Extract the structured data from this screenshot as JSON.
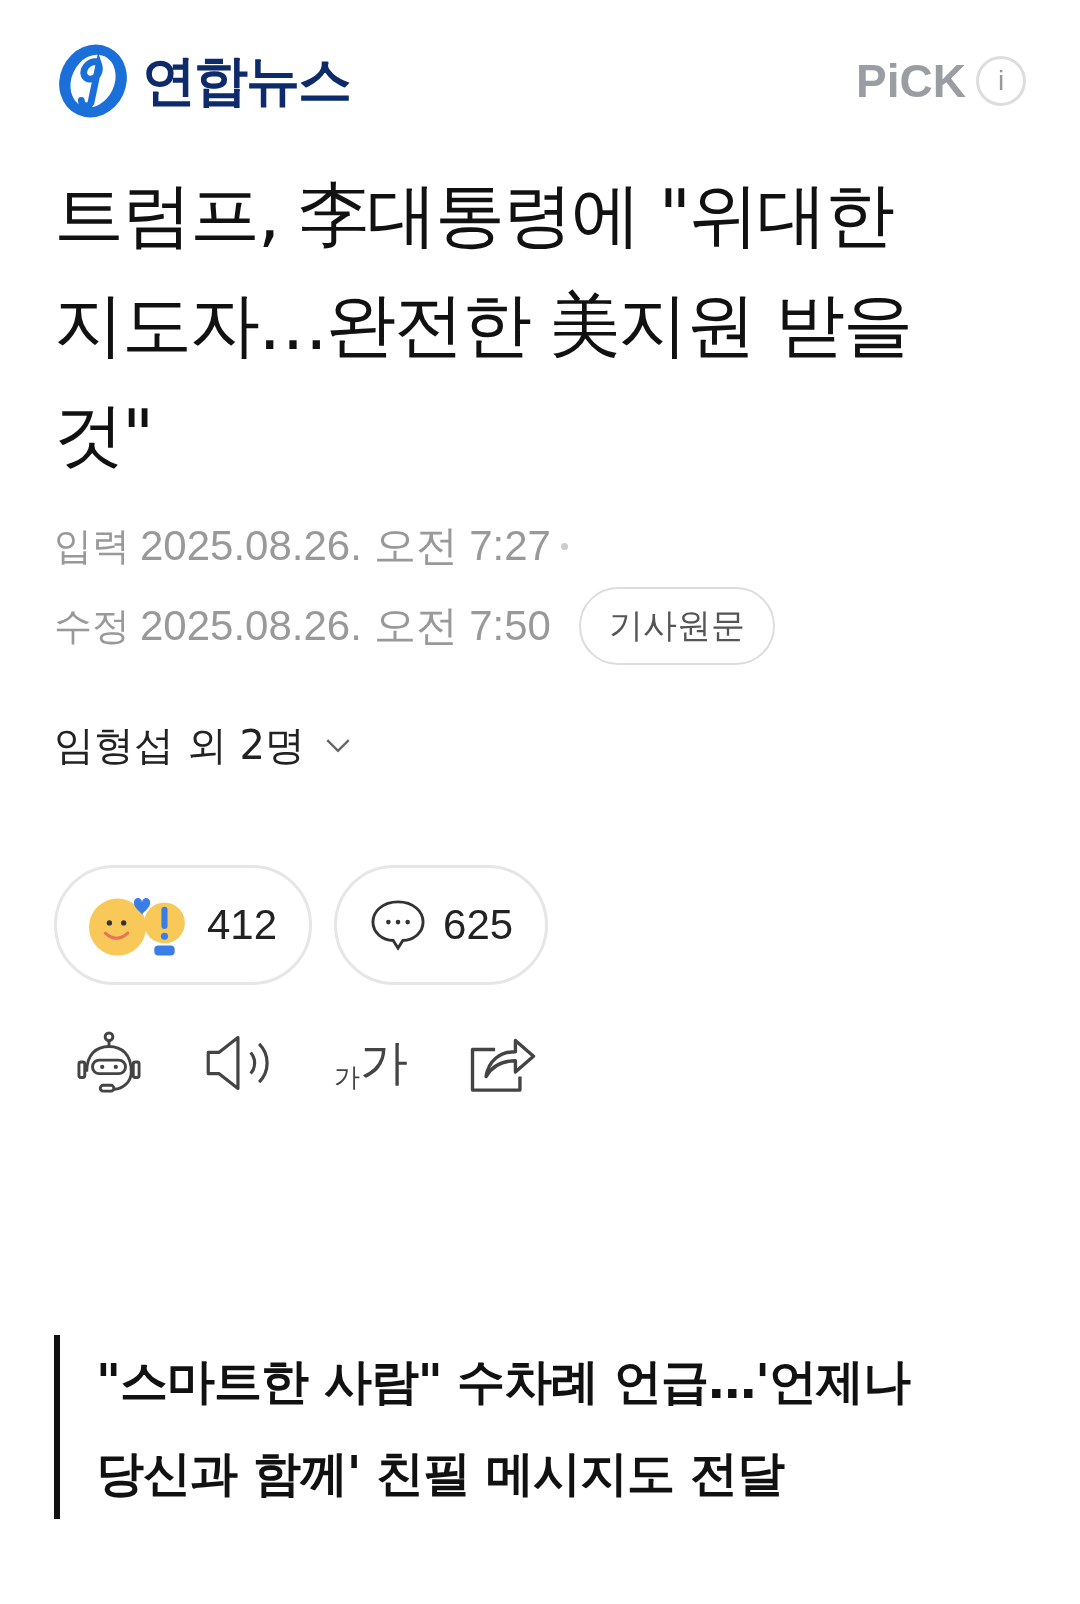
{
  "header": {
    "logo_text": "연합뉴스",
    "pick_label": "PiCK",
    "info_icon": "i"
  },
  "headline": "트럼프, 李대통령에 \"위대한 지도자…완전한 美지원 받을 것\"",
  "dates": [
    {
      "label": "입력",
      "value": "2025.08.26. 오전 7:27"
    },
    {
      "label": "수정",
      "value": "2025.08.26. 오전 7:50"
    }
  ],
  "original_button": "기사원문",
  "author": "임형섭 외 2명",
  "reactions": [
    {
      "kind": "emotion",
      "count": "412"
    },
    {
      "kind": "comment",
      "count": "625"
    }
  ],
  "tools": [
    {
      "kind": "robot"
    },
    {
      "kind": "speaker"
    },
    {
      "kind": "font",
      "small": "가",
      "large": "가"
    },
    {
      "kind": "share"
    }
  ],
  "subheadline": "\"스마트한 사람\" 수차례 언급…'언제나 당신과 함께' 친필 메시지도 전달"
}
